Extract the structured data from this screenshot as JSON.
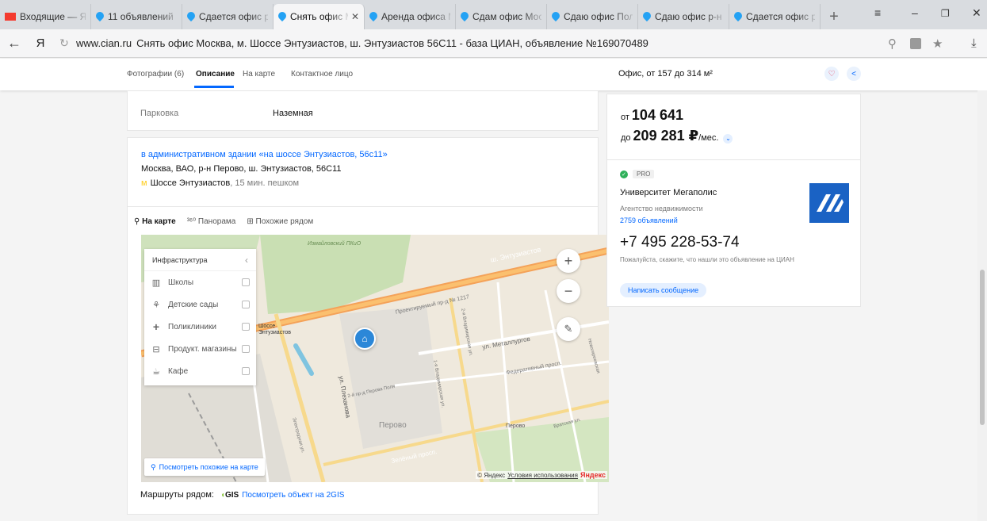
{
  "browser": {
    "tabs": [
      {
        "label": "Входящие — Ян",
        "icon": "mail-icon"
      },
      {
        "label": "11 объявлений",
        "icon": "cian-pin-icon"
      },
      {
        "label": "Сдается офис р",
        "icon": "cian-pin-icon"
      },
      {
        "label": "Снять офис М",
        "icon": "cian-pin-icon",
        "active": true
      },
      {
        "label": "Аренда офиса М",
        "icon": "cian-pin-icon"
      },
      {
        "label": "Сдам офис Мос",
        "icon": "cian-pin-icon"
      },
      {
        "label": "Сдаю офис Пол",
        "icon": "cian-pin-icon"
      },
      {
        "label": "Сдаю офис р-н",
        "icon": "cian-pin-icon"
      },
      {
        "label": "Сдается офис р",
        "icon": "cian-pin-icon"
      }
    ],
    "yandex_letter": "Я",
    "domain": "www.cian.ru",
    "page_title": "Снять офис Москва, м. Шоссе Энтузиастов, ш. Энтузиастов 56С11 - база ЦИАН, объявление №169070489"
  },
  "subnav": {
    "links": [
      "Фотографии (6)",
      "Описание",
      "На карте",
      "Контактное лицо"
    ],
    "active_index": 1,
    "offer_title": "Офис, от 157 до 314 м²"
  },
  "parking": {
    "label": "Парковка",
    "value": "Наземная"
  },
  "address": {
    "building_link": "в административном здании «на шоссе Энтузиастов, 56с11»",
    "full": "Москва, ВАО, р-н Перово, ш. Энтузиастов, 56С11",
    "metro": "Шоссе Энтузиастов",
    "metro_time": ", 15 мин. пешком",
    "metro_color": "#ffcd1c"
  },
  "map_tabs": {
    "map": "На карте",
    "panorama": "Панорама",
    "nearby": "Похожие рядом"
  },
  "infrastructure": {
    "title": "Инфраструктура",
    "items": [
      "Школы",
      "Детские сады",
      "Поликлиники",
      "Продукт. магазины",
      "Кафе"
    ]
  },
  "map_labels": {
    "see_similar": "Посмотреть похожие на карте",
    "copyright": "© Яндекс",
    "terms": "Условия использования",
    "brand": "Яндекс",
    "streets": {
      "highway": "ш. Энтузиастов",
      "proj": "Проектируемый пр-д № 1217",
      "metallurg": "ул. Металлургов",
      "federal": "Федеративный просп.",
      "plekhanova": "ул. Плеханова",
      "perovo": "Перово",
      "perovo_metro": "Перово",
      "zeleny": "Зелёный просп.",
      "vladimir2": "2-я Владимирская ул.",
      "vladimir1": "1-я Владимирская ул.",
      "perova_pole": "2-й пр-д Перова Поля",
      "elektrodnaya": "Электродная ул.",
      "bratskaya": "Братская ул.",
      "novogireev": "Новогиреевская",
      "shosse_station": "Шоссе Энтузиастов",
      "izm": "Измайловский ПКиО"
    }
  },
  "routes": {
    "label": "Маршруты рядом:",
    "gis_logo": "GIS",
    "gis_link": "Посмотреть объект на 2GIS"
  },
  "price": {
    "from_prefix": "от",
    "from": "104 641",
    "to_prefix": "до",
    "to": "209 281 ₽",
    "unit": "/мес."
  },
  "agent": {
    "badge": "PRO",
    "name": "Университет Мегаполис",
    "type": "Агентство недвижимости",
    "offers": "2759 объявлений",
    "phone": "+7 495 228-53-74",
    "note": "Пожалуйста, скажите, что нашли это объявление на ЦИАН",
    "message_button": "Написать сообщение",
    "logo_color": "#1a62c4"
  },
  "colors": {
    "accent": "#0468ff",
    "heart": "#e84260"
  }
}
